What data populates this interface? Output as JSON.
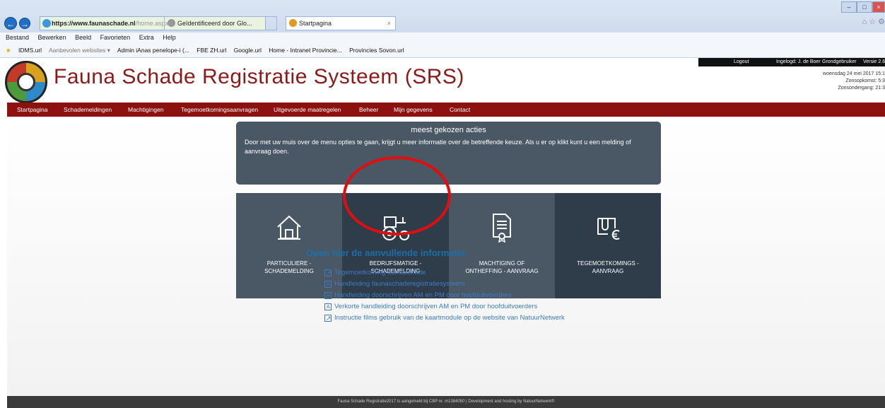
{
  "browser": {
    "address_domain": "https://www.faunaschade.nl",
    "address_path": "/home.aspx",
    "tabs": [
      {
        "label": "Geïdentificeerd door Glo..."
      },
      {
        "label": "Startpagina"
      }
    ],
    "menu": [
      "Bestand",
      "Bewerken",
      "Beeld",
      "Favorieten",
      "Extra",
      "Help"
    ],
    "favorites": [
      {
        "label": "IDMS.url",
        "muted": false
      },
      {
        "label": "Aanbevolen websites ▾",
        "muted": true
      },
      {
        "label": "Admin iAnas penelope-i (...",
        "muted": false
      },
      {
        "label": "FBE ZH.url",
        "muted": false
      },
      {
        "label": "Google.url",
        "muted": false
      },
      {
        "label": "Home - Intranet Provincie...",
        "muted": false
      },
      {
        "label": "Provincies Sovon.url",
        "muted": false
      }
    ]
  },
  "userbar": {
    "logout": "Logout",
    "logged_in": "Ingelogd: J. de Boer",
    "role": "Grondgebruiker",
    "version": "Versie 2.6."
  },
  "dateinfo": {
    "date": "woensdag 24 mei 2017 15:1",
    "sunrise": "Zonsopkomst: 5:3",
    "sunset": "Zonsondergang: 21:3"
  },
  "site": {
    "title": "Fauna Schade Registratie Systeem (SRS)"
  },
  "nav": [
    "Startpagina",
    "Schademeldingen",
    "Machtigingen",
    "Tegemoetkomingsaanvragen",
    "Uitgevoerde maatregelen",
    "Beheer",
    "Mijn gegevens",
    "Contact"
  ],
  "panel": {
    "title": "meest gekozen acties",
    "text": "Door met uw muis over de menu opties te gaan, krijgt u meer informatie over de betreffende keuze. Als u er op klikt kunt u een melding of aanvraag doen."
  },
  "tiles": [
    {
      "line1": "PARTICULIERE -",
      "line2": "SCHADEMELDING",
      "icon": "house-icon",
      "color": "#4a5865"
    },
    {
      "line1": "BEDRIJFSMATIGE -",
      "line2": "SCHADEMELDING",
      "icon": "tractor-icon",
      "color": "#2f3d4b"
    },
    {
      "line1": "MACHTIGING OF",
      "line2": "ONTHEFFING - AANVRAAG",
      "icon": "certificate-icon",
      "color": "#4a5865"
    },
    {
      "line1": "TEGEMOETKOMINGS -",
      "line2": "AANVRAAG",
      "icon": "euro-document-icon",
      "color": "#2f3d4b"
    }
  ],
  "info": {
    "heading": "Open hier de aanvullende informatie:",
    "links": [
      {
        "label": "Tegemoetkoming faunaschade",
        "type": "ext"
      },
      {
        "label": "Handleiding faunaschaderegistratiesysteem",
        "type": "pdf"
      },
      {
        "label": "Handleiding doorschrijven AM en PM door hoofduitvoerders",
        "type": "pdf"
      },
      {
        "label": "Verkorte handleiding doorschrijven AM en PM door hoofduitvoerders",
        "type": "pdf"
      },
      {
        "label": "Instructie films gebruik van de kaartmodule op de website van NatuurNetwerk",
        "type": "ext"
      }
    ]
  },
  "footer": {
    "text": "Fauna Schade Registratie2017 is aangemeld bij CBP nr. m1384050 | Development and hosting by NatuurNetwerk®"
  },
  "colors": {
    "nav": "#8d1111",
    "title": "#8b1a1a",
    "link": "#3d7cc3",
    "highlight": "#e20d0d"
  }
}
